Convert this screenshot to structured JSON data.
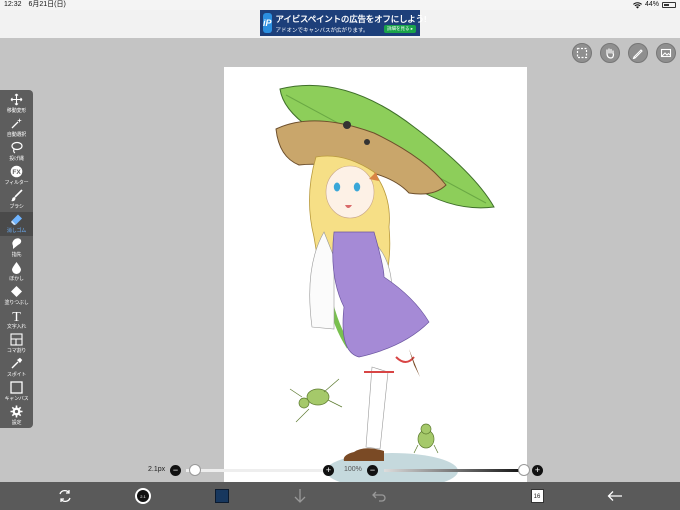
{
  "status_bar": {
    "time": "12:32",
    "date": "6月21日(日)",
    "battery": "44%",
    "battery_level": 0.44
  },
  "ad_banner": {
    "logo": "iP",
    "title": "アイビスペイントの広告をオフにしよう!",
    "subtitle": "アドオンでキャンバスが広がります。",
    "button_label": "詳細を見る ▸"
  },
  "top_tools": [
    {
      "icon": "selection-icon"
    },
    {
      "icon": "hand-icon"
    },
    {
      "icon": "ruler-pencil-icon"
    },
    {
      "icon": "reference-image-icon"
    }
  ],
  "left_tools": [
    {
      "label": "移動変形",
      "icon": "move-icon",
      "active": false
    },
    {
      "label": "自動選択",
      "icon": "magic-wand-icon",
      "active": false
    },
    {
      "label": "投げ縄",
      "icon": "lasso-icon",
      "active": false
    },
    {
      "label": "フィルター",
      "icon": "fx-icon",
      "active": false
    },
    {
      "label": "ブラシ",
      "icon": "brush-icon",
      "active": false
    },
    {
      "label": "消しゴム",
      "icon": "eraser-icon",
      "active": true
    },
    {
      "label": "指先",
      "icon": "finger-icon",
      "active": false
    },
    {
      "label": "ぼかし",
      "icon": "blur-drop-icon",
      "active": false
    },
    {
      "label": "塗りつぶし",
      "icon": "fill-bucket-icon",
      "active": false
    },
    {
      "label": "文字入れ",
      "icon": "text-icon",
      "active": false
    },
    {
      "label": "コマ割り",
      "icon": "frame-divider-icon",
      "active": false
    },
    {
      "label": "スポイト",
      "icon": "eyedropper-icon",
      "active": false
    },
    {
      "label": "キャンバス",
      "icon": "canvas-icon",
      "active": false
    },
    {
      "label": "設定",
      "icon": "gear-icon",
      "active": false
    }
  ],
  "brush_size": {
    "label": "2.1px",
    "minus": "−",
    "plus": "+",
    "value_fraction": 0.02
  },
  "opacity": {
    "label": "100%",
    "minus": "−",
    "plus": "+",
    "value_fraction": 1.0
  },
  "bottom_bar": {
    "brush_size_indicator": "2.1",
    "layer_count": "16",
    "primary_color": "#17375e"
  },
  "colors": {
    "accent": "#6fb4ff",
    "toolbar_bg": "#5d5d5d",
    "workspace_bg": "#c4c4c4"
  }
}
